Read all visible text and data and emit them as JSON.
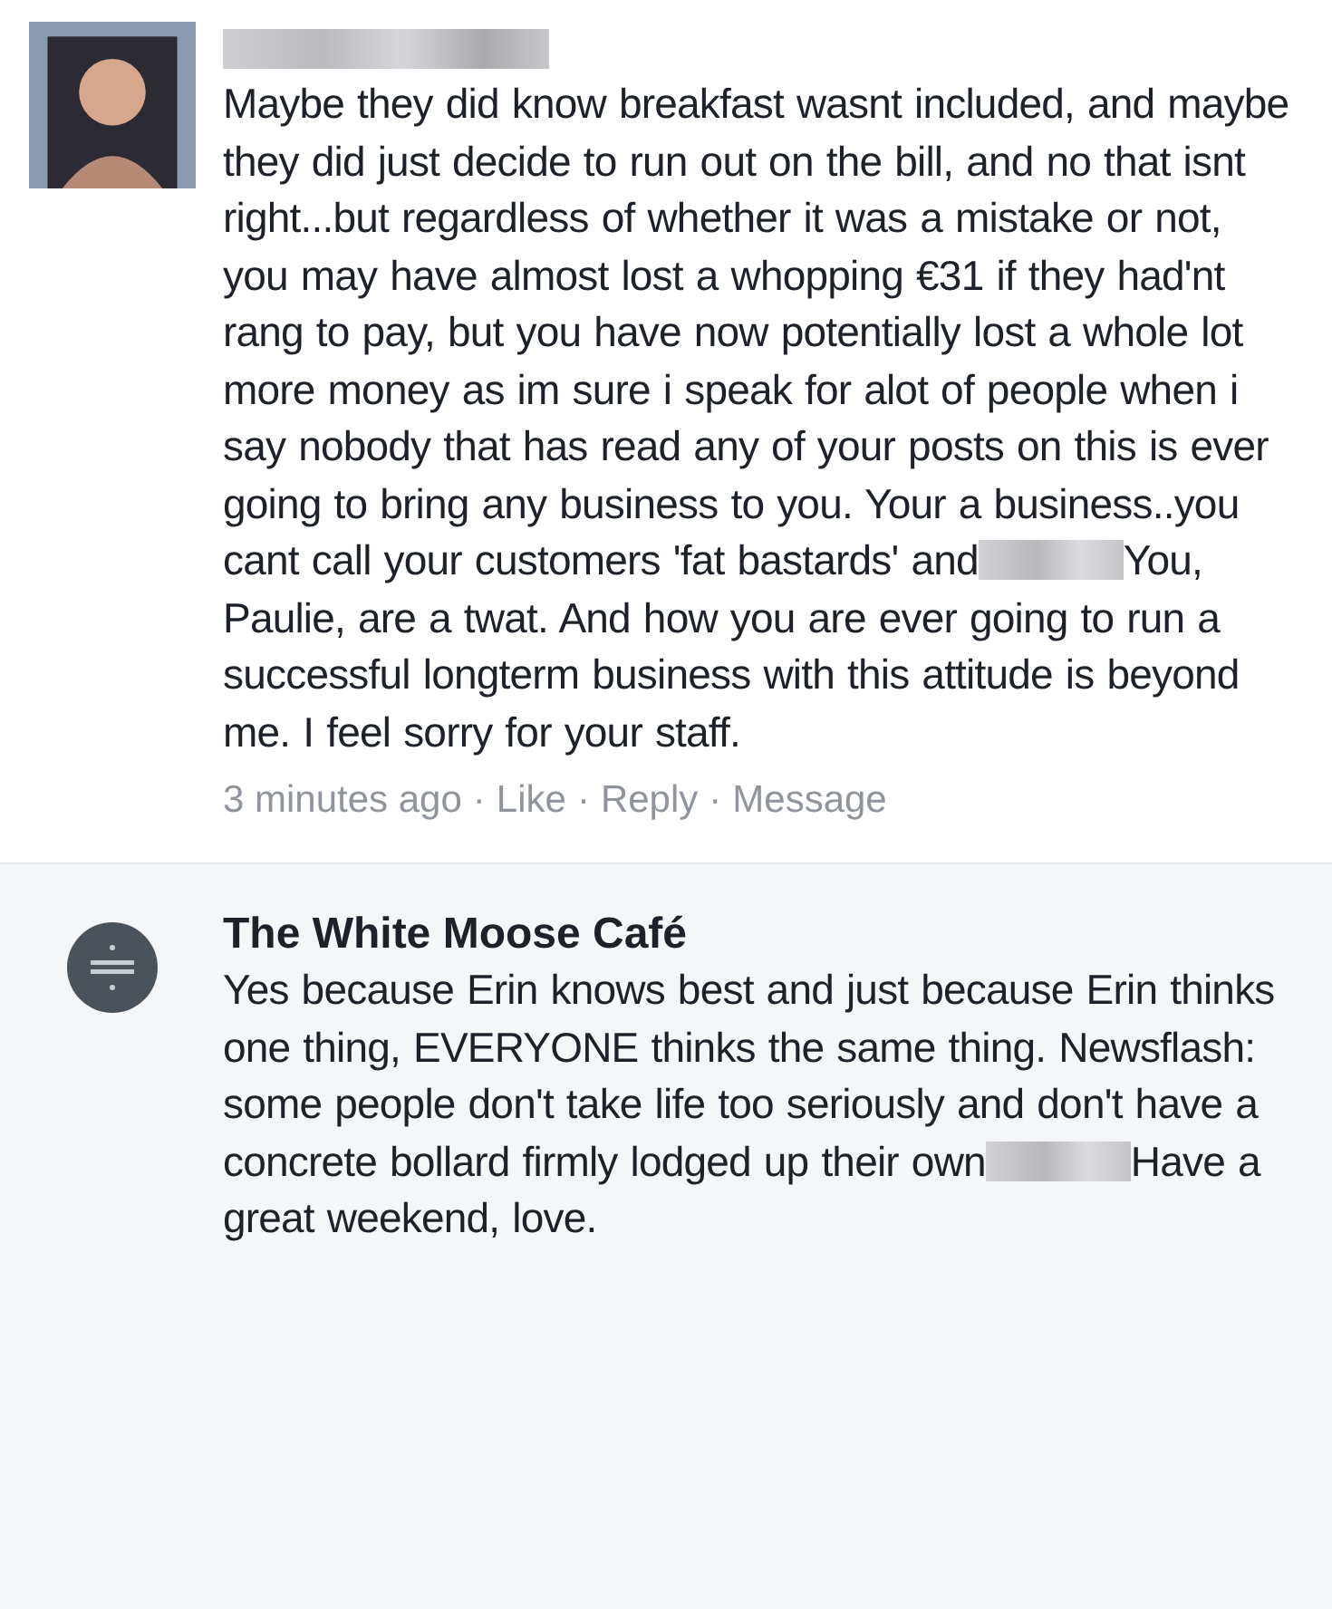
{
  "comments": [
    {
      "author": {
        "kind": "redacted"
      },
      "avatar": {
        "kind": "person"
      },
      "body": [
        {
          "kind": "text",
          "text": "Maybe they did know breakfast wasnt included, and maybe they did just decide to run out on the bill, and no that isnt right...but regardless of whether it was a mistake or not, you may have almost lost a whopping €31 if they had'nt rang to pay, but you have now potentially lost a whole lot more money as im sure i speak for alot of people when i say nobody that has read any of your posts on this is ever going to bring any business to you. Your a business..you cant call your customers 'fat bastards' and"
        },
        {
          "kind": "redacted"
        },
        {
          "kind": "text",
          "text": "You, Paulie, are a twat. And how you are ever going to run a successful longterm business with this attitude is beyond me. I feel sorry for your staff."
        }
      ],
      "meta": {
        "time": "3 minutes ago",
        "separator": "·",
        "actions": [
          "Like",
          "Reply",
          "Message"
        ]
      },
      "highlighted": false
    },
    {
      "author": {
        "kind": "text",
        "text": "The White Moose Café"
      },
      "avatar": {
        "kind": "logo"
      },
      "body": [
        {
          "kind": "text",
          "text": "Yes because Erin knows best and just because Erin thinks one thing, EVERYONE thinks the same thing. Newsflash: some people don't take life too seriously and don't have a concrete bollard firmly lodged up their own"
        },
        {
          "kind": "redacted"
        },
        {
          "kind": "text",
          "text": "Have a great weekend, love."
        }
      ],
      "highlighted": true
    }
  ]
}
